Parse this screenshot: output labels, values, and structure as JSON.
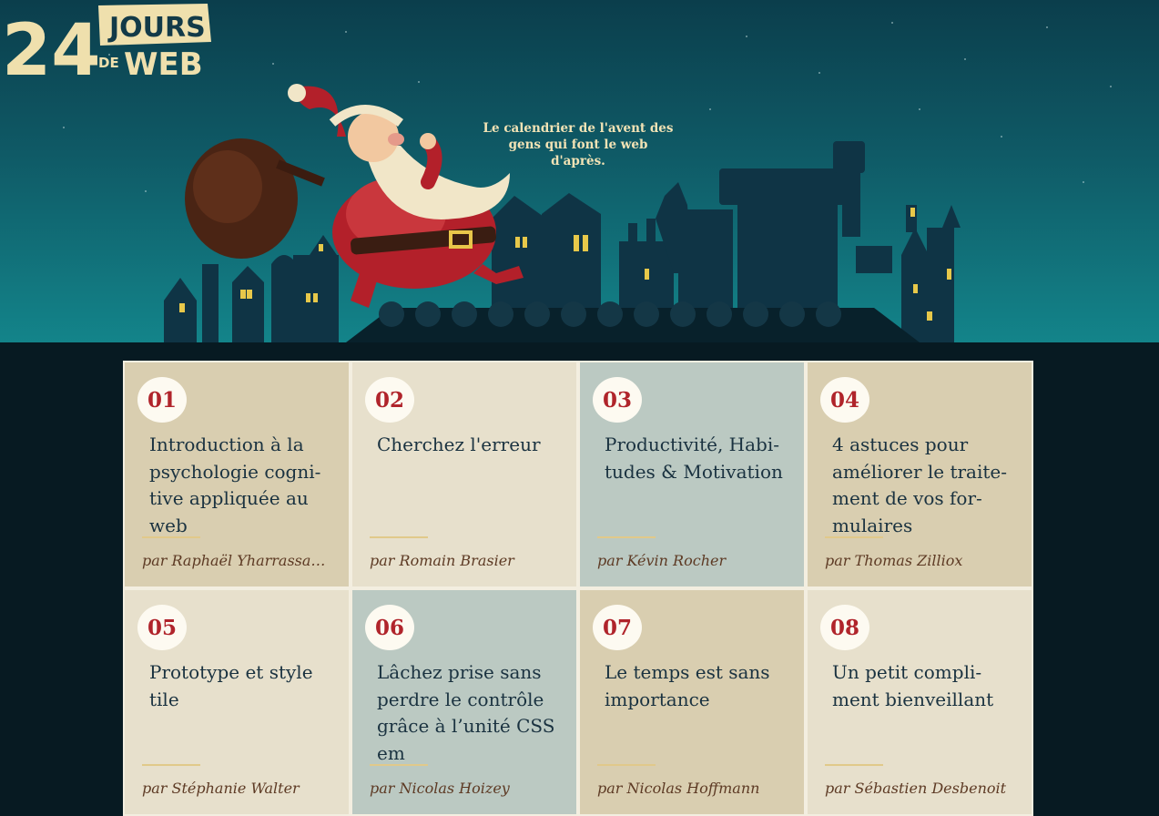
{
  "header": {
    "logo_number": "24",
    "logo_jours": "JOURS",
    "logo_de": "DE",
    "logo_web": "WEB",
    "tagline_line1": "Le calendrier de l'avent des",
    "tagline_line2": "gens qui font le web d'après."
  },
  "colors": {
    "accent_red": "#b0242b",
    "tan": "#d9ceb0",
    "cream": "#e7e0cc",
    "sage": "#bbc9c2",
    "night": "#071a22"
  },
  "days": [
    {
      "number": "01",
      "title": "Introduction à la psychologie cogni­tive appliquée au web",
      "author": "par Raphaël Yharrassa…",
      "color": "tan"
    },
    {
      "number": "02",
      "title": "Cherchez l'erreur",
      "author": "par Romain Brasier",
      "color": "cream"
    },
    {
      "number": "03",
      "title": "Productivité, Habi­tudes & Motivation",
      "author": "par Kévin Rocher",
      "color": "sage"
    },
    {
      "number": "04",
      "title": "4 astuces pour améliorer le traite­ment de vos for­mulaires",
      "author": "par Thomas Zilliox",
      "color": "tan"
    },
    {
      "number": "05",
      "title": "Prototype et style tile",
      "author": "par Stéphanie Walter",
      "color": "cream"
    },
    {
      "number": "06",
      "title": "Lâchez prise sans perdre le contrôle grâce à l’unité CSS em",
      "author": "par Nicolas Hoizey",
      "color": "sage"
    },
    {
      "number": "07",
      "title": "Le temps est sans importance",
      "author": "par Nicolas Hoffmann",
      "color": "tan"
    },
    {
      "number": "08",
      "title": "Un petit compli­ment bienveillant",
      "author": "par Sébastien Desbenoit",
      "color": "cream"
    }
  ]
}
